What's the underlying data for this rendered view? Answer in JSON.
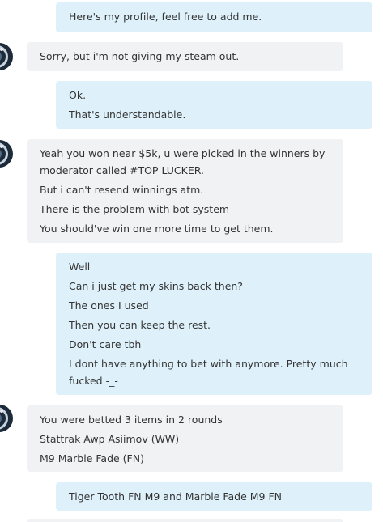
{
  "messages": [
    {
      "direction": "outgoing",
      "lines": [
        "Here's my profile, feel free to add me."
      ]
    },
    {
      "direction": "incoming",
      "sender_avatar": "user-avatar",
      "lines": [
        "Sorry, but i'm not giving my steam out."
      ]
    },
    {
      "direction": "outgoing",
      "lines": [
        "Ok.",
        "That's understandable."
      ]
    },
    {
      "direction": "incoming",
      "sender_avatar": "user-avatar",
      "lines": [
        "Yeah you won near $5k, u were picked in the winners by moderator called #TOP LUCKER.",
        "But i can't resend winnings atm.",
        "There is the problem with bot system",
        "You should've win one more time to get them."
      ]
    },
    {
      "direction": "outgoing",
      "lines": [
        "Well",
        "Can i just get my skins back then?",
        "The ones I used",
        "Then you can keep the rest.",
        "Don't care tbh",
        "I dont have anything to bet with anymore. Pretty much fucked -_-"
      ]
    },
    {
      "direction": "incoming",
      "sender_avatar": "user-avatar",
      "lines": [
        "You were betted 3 items in 2 rounds",
        "Stattrak Awp Asiimov (WW)",
        "M9 Marble Fade (FN)"
      ]
    },
    {
      "direction": "outgoing",
      "lines": [
        "Tiger Tooth FN M9 and Marble Fade M9 FN"
      ]
    }
  ],
  "colors": {
    "outgoing_bubble": "#def1fa",
    "incoming_bubble": "#f1f2f4",
    "text": "#333333"
  }
}
